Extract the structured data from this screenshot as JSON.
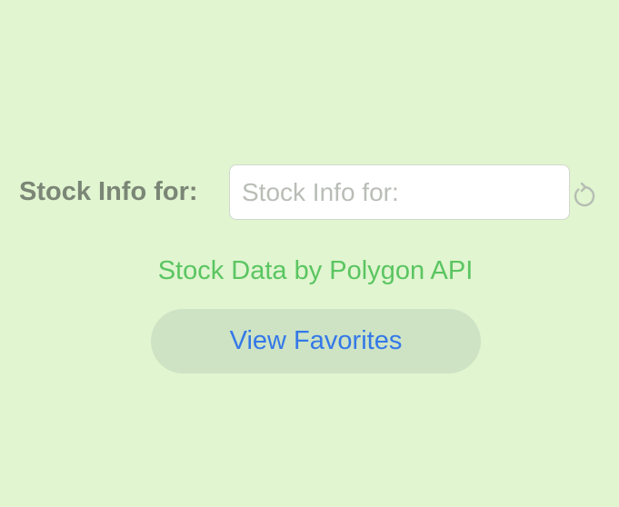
{
  "search": {
    "label": "Stock Info for:",
    "value": "",
    "placeholder": "Stock Info for:"
  },
  "refresh": {
    "icon": "refresh-icon"
  },
  "credit_text": "Stock Data by Polygon API",
  "favorites_button_label": "View Favorites",
  "colors": {
    "background": "#e0f5d0",
    "label": "#7b8676",
    "placeholder": "#b9bdb6",
    "credit": "#5bc561",
    "button_bg": "#cde3c4",
    "button_text": "#3478e8",
    "icon": "#b6bdb3"
  }
}
